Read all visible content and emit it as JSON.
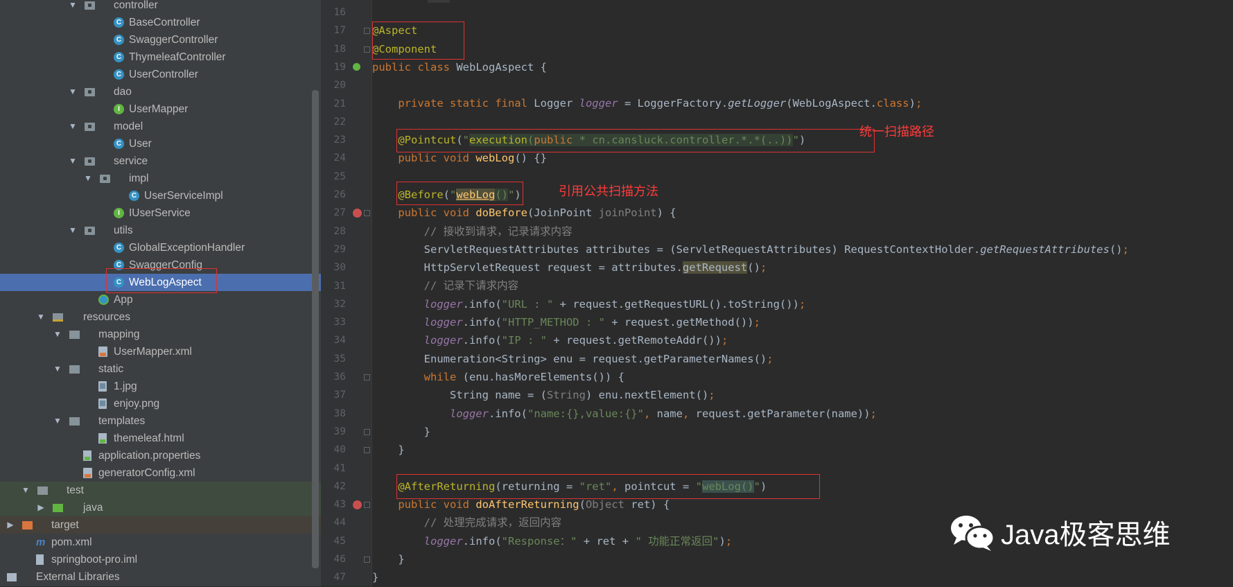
{
  "tree": {
    "rows": [
      {
        "label": "controller",
        "indent": 122,
        "arrow": "▼",
        "icon": "folder",
        "iconName": "package-folder-icon",
        "lbl": 164
      },
      {
        "label": "BaseController",
        "indent": 164,
        "arrow": "",
        "icon": "cls",
        "iconName": "class-icon",
        "lbl": 186
      },
      {
        "label": "SwaggerController",
        "indent": 164,
        "arrow": "",
        "icon": "cls",
        "iconName": "class-icon",
        "lbl": 186
      },
      {
        "label": "ThymeleafController",
        "indent": 164,
        "arrow": "",
        "icon": "cls",
        "iconName": "class-icon",
        "lbl": 186
      },
      {
        "label": "UserController",
        "indent": 164,
        "arrow": "",
        "icon": "cls",
        "iconName": "class-icon",
        "lbl": 186
      },
      {
        "label": "dao",
        "indent": 122,
        "arrow": "▼",
        "icon": "folder",
        "iconName": "package-folder-icon",
        "lbl": 164
      },
      {
        "label": "UserMapper",
        "indent": 164,
        "arrow": "",
        "icon": "intf",
        "iconName": "interface-icon",
        "lbl": 186
      },
      {
        "label": "model",
        "indent": 122,
        "arrow": "▼",
        "icon": "folder",
        "iconName": "package-folder-icon",
        "lbl": 164
      },
      {
        "label": "User",
        "indent": 164,
        "arrow": "",
        "icon": "cls",
        "iconName": "class-icon",
        "lbl": 186
      },
      {
        "label": "service",
        "indent": 122,
        "arrow": "▼",
        "icon": "folder",
        "iconName": "package-folder-icon",
        "lbl": 164
      },
      {
        "label": "impl",
        "indent": 144,
        "arrow": "▼",
        "icon": "folder",
        "iconName": "package-folder-icon",
        "lbl": 186
      },
      {
        "label": "UserServiceImpl",
        "indent": 186,
        "arrow": "",
        "icon": "cls",
        "iconName": "class-icon",
        "lbl": 208
      },
      {
        "label": "IUserService",
        "indent": 164,
        "arrow": "",
        "icon": "intf",
        "iconName": "interface-icon",
        "lbl": 186
      },
      {
        "label": "utils",
        "indent": 122,
        "arrow": "▼",
        "icon": "folder",
        "iconName": "package-folder-icon",
        "lbl": 164
      },
      {
        "label": "GlobalExceptionHandler",
        "indent": 164,
        "arrow": "",
        "icon": "cls",
        "iconName": "class-icon",
        "lbl": 186
      },
      {
        "label": "SwaggerConfig",
        "indent": 164,
        "arrow": "",
        "icon": "cls",
        "iconName": "class-icon",
        "lbl": 186
      },
      {
        "label": "WebLogAspect",
        "indent": 164,
        "arrow": "",
        "icon": "cls",
        "iconName": "class-icon",
        "lbl": 186,
        "selected": true
      },
      {
        "label": "App",
        "indent": 142,
        "arrow": "",
        "icon": "app",
        "iconName": "app-class-icon",
        "lbl": 164
      },
      {
        "label": "resources",
        "indent": 76,
        "arrow": "▼",
        "icon": "folder-res",
        "iconName": "resources-folder-icon",
        "lbl": 120
      },
      {
        "label": "mapping",
        "indent": 100,
        "arrow": "▼",
        "icon": "folder-plain",
        "iconName": "folder-icon",
        "lbl": 142
      },
      {
        "label": "UserMapper.xml",
        "indent": 142,
        "arrow": "",
        "icon": "xml",
        "iconName": "xml-file-icon",
        "lbl": 164
      },
      {
        "label": "static",
        "indent": 100,
        "arrow": "▼",
        "icon": "folder-plain",
        "iconName": "folder-icon",
        "lbl": 142
      },
      {
        "label": "1.jpg",
        "indent": 142,
        "arrow": "",
        "icon": "img",
        "iconName": "image-file-icon",
        "lbl": 164
      },
      {
        "label": "enjoy.png",
        "indent": 142,
        "arrow": "",
        "icon": "img",
        "iconName": "image-file-icon",
        "lbl": 164
      },
      {
        "label": "templates",
        "indent": 100,
        "arrow": "▼",
        "icon": "folder-plain",
        "iconName": "folder-icon",
        "lbl": 142
      },
      {
        "label": "themeleaf.html",
        "indent": 142,
        "arrow": "",
        "icon": "html",
        "iconName": "html-file-icon",
        "lbl": 164
      },
      {
        "label": "application.properties",
        "indent": 120,
        "arrow": "",
        "icon": "props",
        "iconName": "properties-file-icon",
        "lbl": 142
      },
      {
        "label": "generatorConfig.xml",
        "indent": 120,
        "arrow": "",
        "icon": "xml",
        "iconName": "xml-file-icon",
        "lbl": 142
      },
      {
        "label": "test",
        "indent": 54,
        "arrow": "▼",
        "icon": "folder-gray",
        "iconName": "test-folder-icon",
        "lbl": 96,
        "cls": "test-row"
      },
      {
        "label": "java",
        "indent": 76,
        "arrow": "▶",
        "icon": "folder-green",
        "iconName": "test-source-folder-icon",
        "lbl": 120,
        "cls": "test-row"
      },
      {
        "label": "target",
        "indent": 32,
        "arrow": "▶",
        "icon": "folder-orange",
        "iconName": "excluded-folder-icon",
        "lbl": 74,
        "cls": "target-row"
      },
      {
        "label": "pom.xml",
        "indent": 52,
        "arrow": "",
        "icon": "maven",
        "iconName": "maven-file-icon",
        "lbl": 74
      },
      {
        "label": "springboot-pro.iml",
        "indent": 52,
        "arrow": "",
        "icon": "iml",
        "iconName": "iml-file-icon",
        "lbl": 74
      },
      {
        "label": "External Libraries",
        "indent": 10,
        "arrow": "▶",
        "icon": "lib",
        "iconName": "libraries-icon",
        "lbl": 52
      }
    ]
  },
  "editor": {
    "line_numbers": [
      "16",
      "17",
      "18",
      "19",
      "20",
      "21",
      "22",
      "23",
      "24",
      "25",
      "26",
      "27",
      "28",
      "29",
      "30",
      "31",
      "32",
      "33",
      "34",
      "35",
      "36",
      "37",
      "38",
      "39",
      "40",
      "41",
      "42",
      "43",
      "44",
      "45",
      "46",
      "47"
    ],
    "notes": {
      "scan_path": "统一扫描路径",
      "ref_method": "引用公共扫描方法"
    }
  },
  "watermark": {
    "text": "Java极客思维",
    "icon": "wechat-icon"
  }
}
